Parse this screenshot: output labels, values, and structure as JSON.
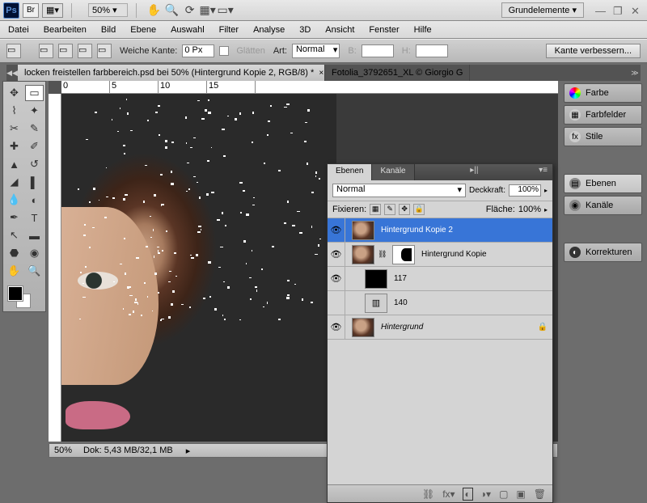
{
  "topbar": {
    "zoom": "50%",
    "workspace": "Grundelemente"
  },
  "menu": [
    "Datei",
    "Bearbeiten",
    "Bild",
    "Ebene",
    "Auswahl",
    "Filter",
    "Analyse",
    "3D",
    "Ansicht",
    "Fenster",
    "Hilfe"
  ],
  "optbar": {
    "weiche_kante": "Weiche Kante:",
    "weiche_val": "0 Px",
    "glaetten": "Glätten",
    "art": "Art:",
    "art_val": "Normal",
    "b": "B:",
    "h": "H:",
    "refine": "Kante verbessern..."
  },
  "tabs": {
    "active": "locken freistellen farbbereich.psd bei 50% (Hintergrund Kopie 2, RGB/8) *",
    "inactive": "Fotolia_3792651_XL © Giorgio G"
  },
  "status": {
    "zoom": "50%",
    "doc": "Dok: 5,43 MB/32,1 MB"
  },
  "dock": {
    "farbe": "Farbe",
    "farbfelder": "Farbfelder",
    "stile": "Stile",
    "ebenen": "Ebenen",
    "kanaele": "Kanäle",
    "korrekturen": "Korrekturen"
  },
  "layers_panel": {
    "tab_ebenen": "Ebenen",
    "tab_kanaele": "Kanäle",
    "blend": "Normal",
    "deckkraft_lbl": "Deckkraft:",
    "deckkraft": "100%",
    "fixieren": "Fixieren:",
    "flaeche_lbl": "Fläche:",
    "flaeche": "100%",
    "layers": [
      {
        "name": "Hintergrund Kopie 2",
        "sel": true,
        "eye": true,
        "thumb": "face"
      },
      {
        "name": "Hintergrund Kopie",
        "eye": true,
        "thumb": "face",
        "mask": true,
        "link": true
      },
      {
        "name": "117",
        "eye": true,
        "thumb": "black",
        "sub": true
      },
      {
        "name": "140",
        "eye": false,
        "thumb": "adj",
        "sub": true
      },
      {
        "name": "Hintergrund",
        "eye": true,
        "thumb": "face",
        "locked": true,
        "ital": true
      }
    ]
  },
  "rulers": [
    "0",
    "5",
    "10",
    "15"
  ]
}
